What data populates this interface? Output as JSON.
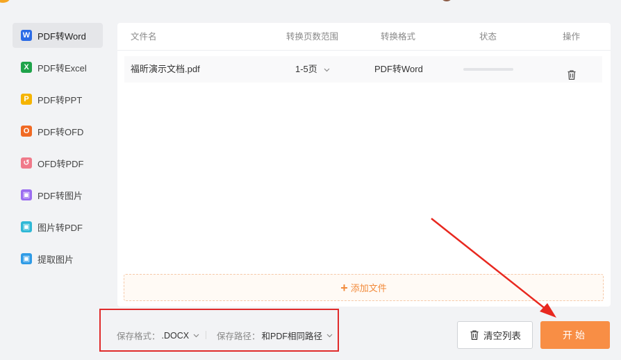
{
  "sidebar": {
    "items": [
      {
        "label": "PDF转Word",
        "icon": "word-icon",
        "glyph": "W",
        "color": "#2b6be6"
      },
      {
        "label": "PDF转Excel",
        "icon": "excel-icon",
        "glyph": "X",
        "color": "#1fa34a"
      },
      {
        "label": "PDF转PPT",
        "icon": "ppt-icon",
        "glyph": "P",
        "color": "#f5b400"
      },
      {
        "label": "PDF转OFD",
        "icon": "ofd-icon",
        "glyph": "O",
        "color": "#f06a24"
      },
      {
        "label": "OFD转PDF",
        "icon": "ofd-to-pdf-icon",
        "glyph": "↺",
        "color": "#f07a8a"
      },
      {
        "label": "PDF转图片",
        "icon": "pdf-to-image-icon",
        "glyph": "▣",
        "color": "#9b6cf0"
      },
      {
        "label": "图片转PDF",
        "icon": "image-to-pdf-icon",
        "glyph": "▣",
        "color": "#2fb8d6"
      },
      {
        "label": "提取图片",
        "icon": "extract-image-icon",
        "glyph": "▣",
        "color": "#2f9be6"
      }
    ]
  },
  "table": {
    "headers": {
      "name": "文件名",
      "range": "转换页数范围",
      "format": "转换格式",
      "status": "状态",
      "action": "操作"
    },
    "rows": [
      {
        "name": "福昕演示文档.pdf",
        "range": "1-5页",
        "format": "PDF转Word",
        "progress": 0
      }
    ]
  },
  "add_file": {
    "label": "添加文件"
  },
  "options": {
    "save_format_label": "保存格式：",
    "save_format_value": ".DOCX",
    "save_path_label": "保存路径：",
    "save_path_value": "和PDF相同路径"
  },
  "buttons": {
    "clear": "清空列表",
    "start": "开始"
  },
  "colors": {
    "accent": "#f88e45",
    "highlight": "#e02a2a"
  }
}
